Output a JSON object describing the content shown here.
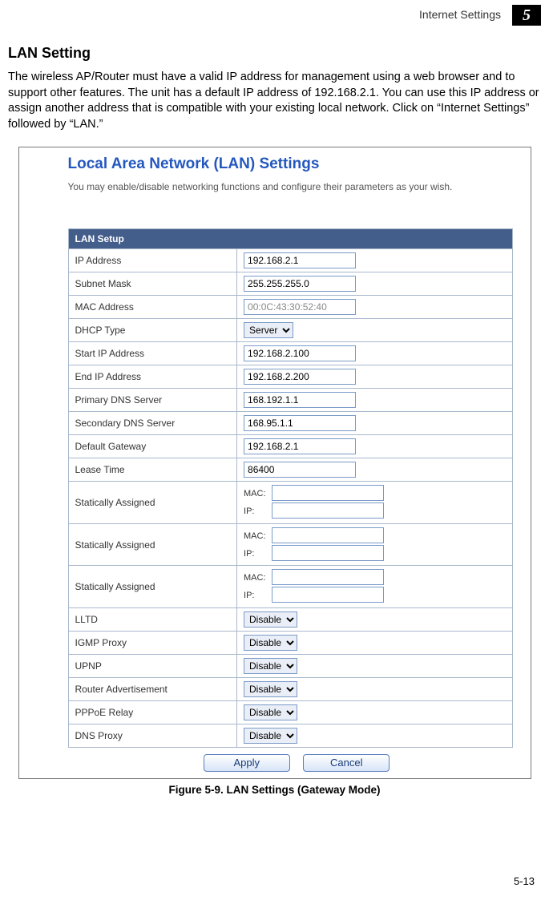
{
  "header": {
    "breadcrumb": "Internet Settings",
    "chapter_number": "5"
  },
  "section": {
    "heading": "LAN Setting",
    "body": "The wireless AP/Router must have a valid IP address for management using a web browser and to support other features. The unit has a default IP address of 192.168.2.1. You can use this IP address or assign another address that is compatible with your existing local network. Click on “Internet Settings” followed by “LAN.”"
  },
  "panel": {
    "title": "Local Area Network (LAN) Settings",
    "description": "You may enable/disable networking functions and configure their parameters as your wish.",
    "group_header": "LAN Setup",
    "rows": {
      "ip_address_label": "IP Address",
      "ip_address_value": "192.168.2.1",
      "subnet_label": "Subnet Mask",
      "subnet_value": "255.255.255.0",
      "mac_label": "MAC Address",
      "mac_value": "00:0C:43:30:52:40",
      "dhcp_label": "DHCP Type",
      "dhcp_value": "Server",
      "start_ip_label": "Start IP Address",
      "start_ip_value": "192.168.2.100",
      "end_ip_label": "End IP Address",
      "end_ip_value": "192.168.2.200",
      "primary_dns_label": "Primary DNS Server",
      "primary_dns_value": "168.192.1.1",
      "secondary_dns_label": "Secondary DNS Server",
      "secondary_dns_value": "168.95.1.1",
      "gateway_label": "Default Gateway",
      "gateway_value": "192.168.2.1",
      "lease_label": "Lease Time",
      "lease_value": "86400",
      "static_label": "Statically Assigned",
      "static_mac_prefix": "MAC:",
      "static_ip_prefix": "IP:",
      "lltd_label": "LLTD",
      "lltd_value": "Disable",
      "igmp_label": "IGMP Proxy",
      "igmp_value": "Disable",
      "upnp_label": "UPNP",
      "upnp_value": "Disable",
      "router_adv_label": "Router Advertisement",
      "router_adv_value": "Disable",
      "pppoe_label": "PPPoE Relay",
      "pppoe_value": "Disable",
      "dns_proxy_label": "DNS Proxy",
      "dns_proxy_value": "Disable"
    },
    "buttons": {
      "apply": "Apply",
      "cancel": "Cancel"
    }
  },
  "figure_caption": "Figure 5-9.   LAN Settings (Gateway Mode)",
  "page_number": "5-13"
}
